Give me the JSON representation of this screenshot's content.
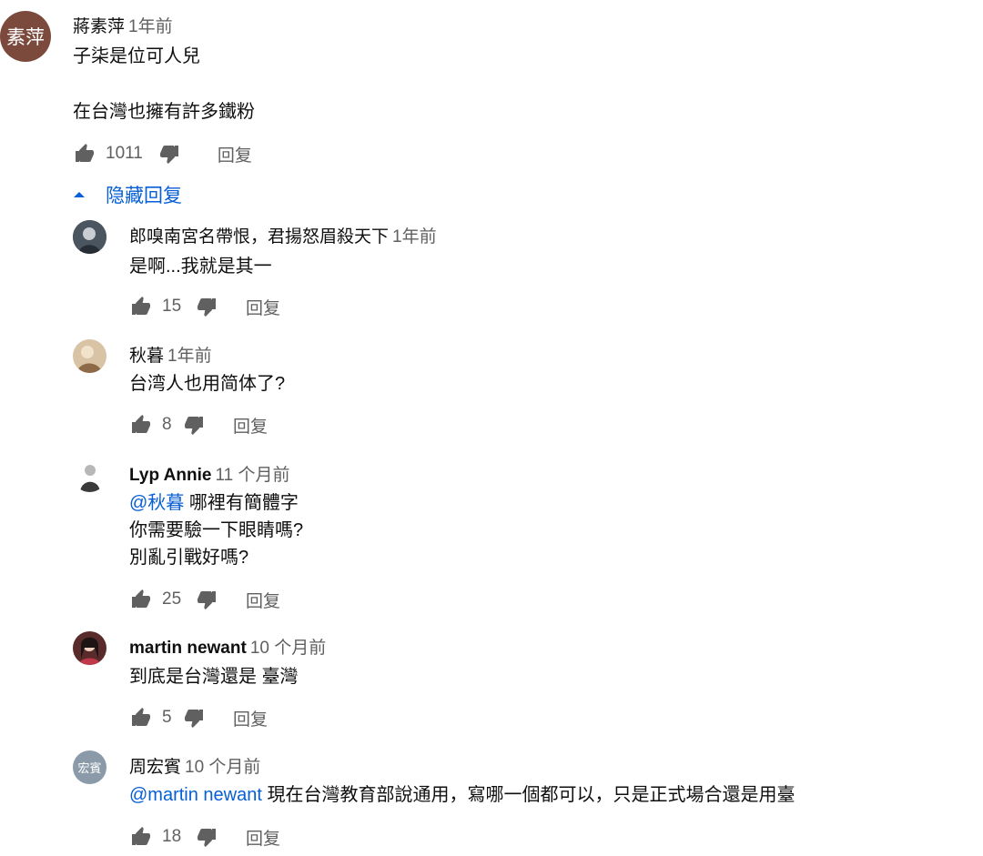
{
  "top_comment": {
    "avatar_text": "素萍",
    "author": "蔣素萍",
    "time": "1年前",
    "line1": "子柒是位可人兒",
    "line2": "在台灣也擁有許多鐵粉",
    "likes": "1011",
    "reply_label": "回复"
  },
  "hide_replies_label": "隐藏回复",
  "replies": [
    {
      "author": "郎嗅南宮名帶恨，君揚怒眉殺天下",
      "time": "1年前",
      "text": "是啊...我就是其一",
      "likes": "15",
      "reply_label": "回复"
    },
    {
      "author": "秋暮",
      "time": "1年前",
      "text": "台湾人也用简体了?",
      "likes": "8",
      "reply_label": "回复"
    },
    {
      "author": "Lyp Annie",
      "time": "11 个月前",
      "mention": "@秋暮",
      "text_after_mention": " 哪裡有簡體字",
      "line2": "你需要驗一下眼睛嗎?",
      "line3": "別亂引戰好嗎?",
      "likes": "25",
      "reply_label": "回复"
    },
    {
      "author": "martin newant",
      "time": "10 个月前",
      "text": "到底是台灣還是 臺灣",
      "likes": "5",
      "reply_label": "回复"
    },
    {
      "author": "周宏賓",
      "avatar_text": "宏賓",
      "time": "10 个月前",
      "mention": "@martin newant",
      "text_after_mention": " 現在台灣教育部說通用，寫哪一個都可以，只是正式場合還是用臺",
      "likes": "18",
      "reply_label": "回复"
    }
  ],
  "icons": {
    "like": "thumbs-up-icon",
    "dislike": "thumbs-down-icon",
    "collapse": "caret-up-icon"
  },
  "colors": {
    "link": "#065fd4",
    "meta": "#606060",
    "top_avatar": "#7b4a3c",
    "initials_avatar": "#8a9aa8"
  }
}
